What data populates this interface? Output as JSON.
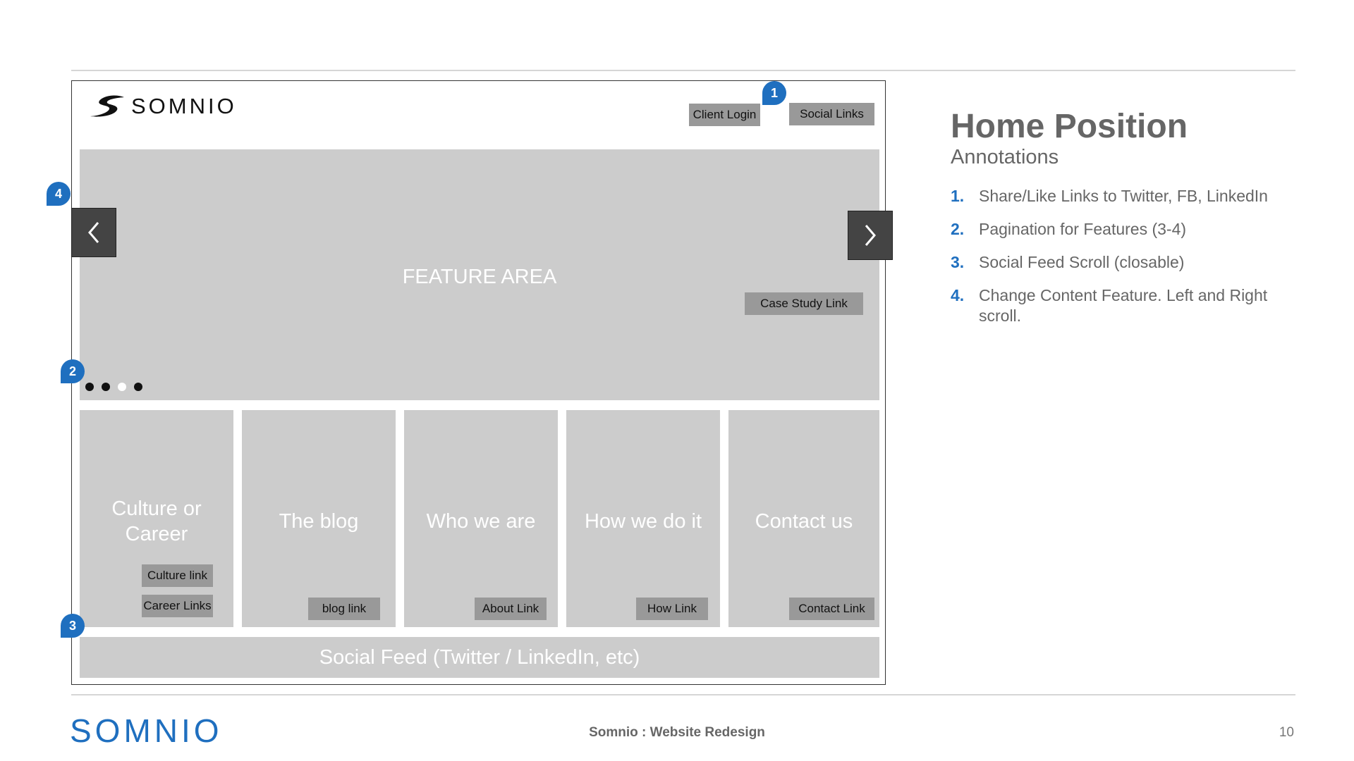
{
  "wireframe": {
    "brand": "SOMNIO",
    "header_buttons": {
      "client_login": "Client Login",
      "social_links": "Social Links"
    },
    "feature": {
      "label": "FEATURE AREA",
      "case_study_link": "Case Study Link",
      "prev_icon": "chevron-left-icon",
      "next_icon": "chevron-right-icon"
    },
    "pagination": {
      "total": 4,
      "active_index": 3
    },
    "tiles": [
      {
        "title": "Culture or Career",
        "links": [
          "Culture link",
          "Career Links"
        ]
      },
      {
        "title": "The blog",
        "links": [
          "blog link"
        ]
      },
      {
        "title": "Who we are",
        "links": [
          "About Link"
        ]
      },
      {
        "title": "How we do it",
        "links": [
          "How Link"
        ]
      },
      {
        "title": "Contact us",
        "links": [
          "Contact Link"
        ]
      }
    ],
    "social_feed": "Social Feed (Twitter / LinkedIn, etc)",
    "markers": [
      "1",
      "2",
      "3",
      "4"
    ]
  },
  "annotations": {
    "title": "Home Position",
    "subtitle": "Annotations",
    "items": [
      {
        "num": "1.",
        "text": "Share/Like Links to Twitter, FB, LinkedIn"
      },
      {
        "num": "2.",
        "text": "Pagination for Features (3-4)"
      },
      {
        "num": "3.",
        "text": "Social Feed Scroll (closable)"
      },
      {
        "num": "4.",
        "text": "Change Content Feature. Left and Right scroll."
      }
    ]
  },
  "footer": {
    "brand": "SOMNIO",
    "center": "Somnio : Website Redesign",
    "page": "10"
  },
  "colors": {
    "accent": "#1f6fbf",
    "wire_fill": "#cccccc",
    "button_fill": "#999999"
  }
}
